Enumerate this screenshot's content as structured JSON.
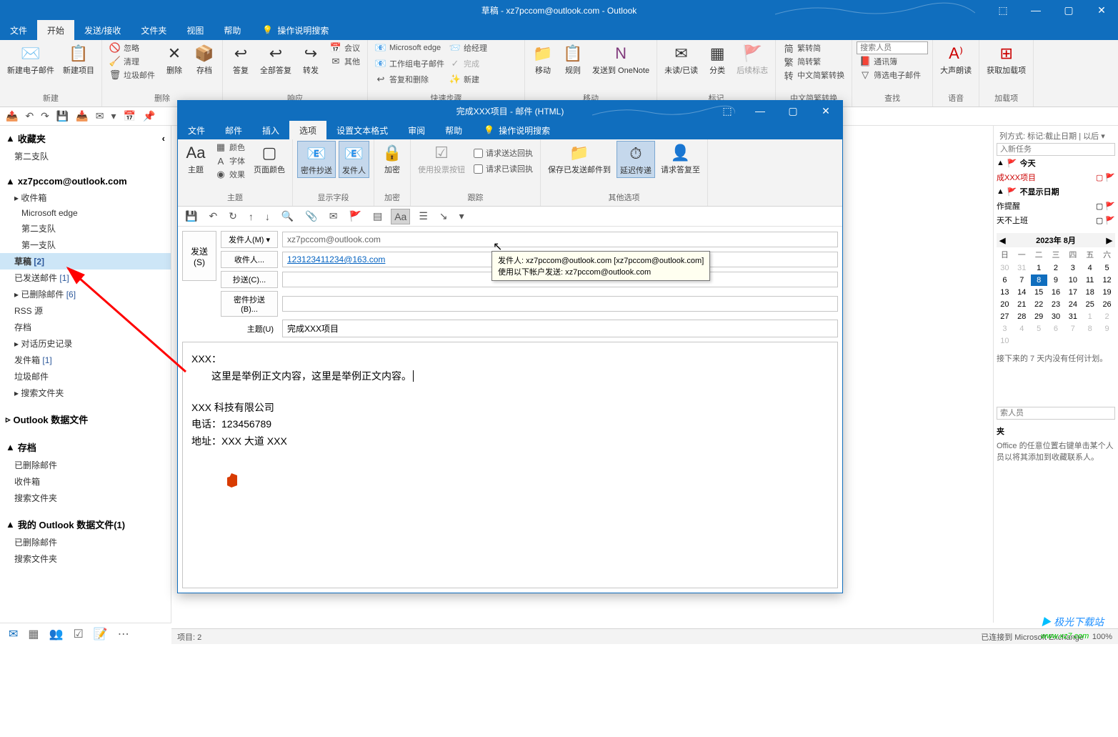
{
  "title": "草稿 - xz7pccom@outlook.com - Outlook",
  "mainTabs": [
    "文件",
    "开始",
    "发送/接收",
    "文件夹",
    "视图",
    "帮助"
  ],
  "mainTabActive": 1,
  "searchHint": "操作说明搜索",
  "ribbon": {
    "new": {
      "newEmail": "新建电子邮件",
      "newItems": "新建项目",
      "label": "新建"
    },
    "delete": {
      "ignore": "忽略",
      "clean": "清理",
      "junk": "垃圾邮件",
      "del": "删除",
      "archive": "存档",
      "label": "删除"
    },
    "respond": {
      "reply": "答复",
      "replyAll": "全部答复",
      "forward": "转发",
      "meeting": "会议",
      "more": "其他",
      "label": "响应"
    },
    "quickSteps": {
      "items": [
        "Microsoft edge",
        "工作组电子邮件",
        "答复和删除",
        "给经理",
        "完成",
        "新建"
      ],
      "label": "快速步骤"
    },
    "move": {
      "move": "移动",
      "rules": "规则",
      "onenote": "发送到 OneNote",
      "label": "移动"
    },
    "tags": {
      "unread": "未读/已读",
      "cat": "分类",
      "followup": "后续标志",
      "label": "标记"
    },
    "chinese": {
      "s2t": "繁转简",
      "t2s": "简转繁",
      "conv": "中文简繁转换",
      "label": "中文简繁转换"
    },
    "find": {
      "search": "搜索人员",
      "addr": "通讯簿",
      "filter": "筛选电子邮件",
      "label": "查找"
    },
    "speech": {
      "aloud": "大声朗读",
      "label": "语音"
    },
    "addins": {
      "get": "获取加载项",
      "label": "加载项"
    }
  },
  "nav": {
    "fav": "收藏夹",
    "favItems": [
      "第二支队"
    ],
    "account": "xz7pccom@outlook.com",
    "inbox": "收件箱",
    "inboxSub": [
      "Microsoft edge",
      "第二支队",
      "第一支队"
    ],
    "drafts": "草稿",
    "draftsCount": "[2]",
    "sent": "已发送邮件",
    "sentCount": "[1]",
    "deleted": "已删除邮件",
    "deletedCount": "[6]",
    "rss": "RSS 源",
    "archive": "存档",
    "history": "对话历史记录",
    "outbox": "发件箱",
    "outboxCount": "[1]",
    "trash": "垃圾邮件",
    "searchFolders": "搜索文件夹",
    "dataFile": "Outlook 数据文件",
    "archiveHdr": "存档",
    "archiveSub": [
      "已删除邮件",
      "收件箱",
      "搜索文件夹"
    ],
    "myData": "我的 Outlook 数据文件(1)",
    "myDataSub": [
      "已删除邮件",
      "搜索文件夹"
    ]
  },
  "todo": {
    "arrangeBy": "列方式: 标记:截止日期",
    "sort": "以后",
    "newTask": "入新任务",
    "today": "今天",
    "item1": "成XXX项目",
    "noDate": "不显示日期",
    "item2": "作提醒",
    "item3": "天不上班",
    "calTitle": "2023年 8月",
    "dows": [
      "日",
      "一",
      "二",
      "三",
      "四",
      "五",
      "六"
    ],
    "calNote": "接下来的 7 天内没有任何计划。",
    "searchPeople": "索人员",
    "favHdr": "夹",
    "favNote": "Office 的任意位置右键单击某个人员以将其添加到收藏联系人。"
  },
  "compose": {
    "title": "完成XXX项目 - 邮件 (HTML)",
    "tabs": [
      "文件",
      "邮件",
      "插入",
      "选项",
      "设置文本格式",
      "审阅",
      "帮助"
    ],
    "tabActive": 3,
    "searchHint": "操作说明搜索",
    "ribbon": {
      "themes": {
        "theme": "主题",
        "colors": "颜色",
        "fonts": "字体",
        "effects": "效果",
        "pageColor": "页面颜色",
        "label": "主题"
      },
      "showFields": {
        "bcc": "密件抄送",
        "from": "发件人",
        "label": "显示字段"
      },
      "encrypt": {
        "encrypt": "加密",
        "label": "加密"
      },
      "tracking": {
        "vote": "使用投票按钮",
        "receipt1": "请求送达回执",
        "receipt2": "请求已读回执",
        "label": "跟踪"
      },
      "moreOpts": {
        "saveSent": "保存已发送邮件到",
        "delay": "延迟传递",
        "directReply": "请求答复至",
        "label": "其他选项"
      }
    },
    "send": "发送",
    "sendKey": "(S)",
    "fromLabel": "发件人(M)",
    "fromValue": "xz7pccom@outlook.com",
    "toLabel": "收件人...",
    "toValue": "123123411234@163.com",
    "ccLabel": "抄送(C)...",
    "ccValue": "",
    "bccLabel": "密件抄送(B)...",
    "bccValue": "",
    "subjectLabel": "主题(U)",
    "subjectValue": "完成XXX项目",
    "bodyGreeting": "XXX：",
    "bodyContent": "这里是举例正文内容，这里是举例正文内容。",
    "sigCompany": "XXX 科技有限公司",
    "sigPhone": "电话：123456789",
    "sigAddr": "地址：XXX 大道 XXX"
  },
  "tooltip": {
    "line1": "发件人: xz7pccom@outlook.com [xz7pccom@outlook.com]",
    "line2": "使用以下帐户发送: xz7pccom@outlook.com"
  },
  "status": {
    "left": "项目: 2",
    "right": "已连接到 Microsoft Exchange",
    "zoom": "100%"
  },
  "watermark": "极光下载站",
  "watermarkUrl": "www.xz7.com"
}
